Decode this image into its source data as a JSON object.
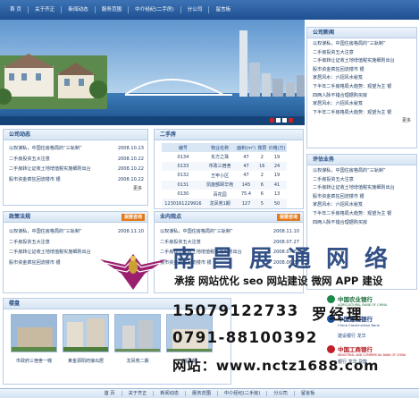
{
  "nav": [
    "首 页",
    "关于齐正",
    "新闻动态",
    "服务范围",
    "中介经纪(二手房)",
    "分公司",
    "留言板"
  ],
  "company_news": {
    "title": "公司新闻",
    "items": [
      "以权谋私，中国住房格局的“三轨制”",
      "二手房投资五大注意",
      "二手房转让证收土地增值税实施细则出台",
      "股市资金疯狂回流楼市  银",
      "家居风水：六招风水秘笈",
      "下半年二手房格局大趋势：观望为主  银",
      "四两人脉不错合理据购买房",
      "家居风水：六招风水秘笈",
      "下半年二手房格局大趋势：观望为主  银"
    ],
    "more": "更多"
  },
  "review": {
    "title": "评估业务",
    "items": [
      "以权谋私，中国住房格局的“三轨制”",
      "二手房投资五大注意",
      "二手房转让证收土地增值税实施细则出台",
      "股市资金疯狂回流楼市  银",
      "家居风水：六招风水秘笈",
      "下半年二手房格局大趋势：观望为主  银",
      "四两人脉不错合理据购买房"
    ],
    "more": "更多"
  },
  "company_dynamic": {
    "title": "公司动态",
    "items": [
      {
        "text": "以权谋私，中国住房格局的“三轨制”",
        "date": "2008.10.23"
      },
      {
        "text": "二手房投资五大注意",
        "date": "2008.10.22"
      },
      {
        "text": "二手房转让证收土地增值税实施细则出台",
        "date": "2008.10.22"
      },
      {
        "text": "股市资金疯狂回流楼市  银",
        "date": "2008.10.22"
      }
    ],
    "more": "更多"
  },
  "policy": {
    "title": "政策法规",
    "tag": "我要咨询",
    "items": [
      {
        "text": "以权谋私，中国住房格局的“三轨制”",
        "date": "2008.11.10"
      },
      {
        "text": "二手房投资五大注意",
        "date": ""
      },
      {
        "text": "二手房转让证收土地增值税实施细则出台",
        "date": ""
      },
      {
        "text": "股市资金疯狂回流楼市  银",
        "date": ""
      }
    ]
  },
  "secondhand": {
    "title": "二手房",
    "columns": [
      "编号",
      "物业名称",
      "面积(m²)",
      "楼层",
      "价格(万)"
    ],
    "rows": [
      [
        "0134",
        "东方之珠",
        "47",
        "2",
        "19"
      ],
      [
        "0133",
        "市政三宿舍",
        "47",
        "16",
        "24"
      ],
      [
        "0132",
        "王牢小区",
        "47",
        "2",
        "19"
      ],
      [
        "0131",
        "凯旋额颐华苑",
        "145",
        "6",
        "41"
      ],
      [
        "0130",
        "百花园",
        "75.4",
        "6",
        "13"
      ],
      [
        "1230161229916",
        "龙凤苑1期",
        "127",
        "5",
        "50"
      ]
    ]
  },
  "industry": {
    "title": "业内观点",
    "tag": "我要咨询",
    "items": [
      {
        "text": "以权谋私，中国住房格局的“三轨制”",
        "date": "2008.11.10"
      },
      {
        "text": "二手房投资五大注意",
        "date": "2008.07.27"
      },
      {
        "text": "二手房转让证收土地增值税实施细则出台",
        "date": "2008.07.02"
      },
      {
        "text": "股市资金疯狂回流楼市  银",
        "date": "2008.06.30"
      }
    ]
  },
  "properties": {
    "title": "楼盘",
    "items": [
      "市政府三宿舍一幢",
      "某金源阳府接出居",
      "龙凤苑二期",
      "桃园观"
    ]
  },
  "watermark": {
    "company": "南昌展通网络",
    "services": "承接 网站优化 seo 网站建设 微网 APP 建设",
    "phone": "15079122733",
    "contact": "罗经理",
    "tel": "0791-88100392",
    "site": "网站：www.nctz1688.com"
  },
  "banks": {
    "abc_cn": "中国农业银行",
    "abc_en": "AGRICULTURAL BANK OF CHINA",
    "ccb_cn": "中国建设银行",
    "ccb_en": "China Construction Bank",
    "sub1": "建设银行",
    "sub2": "龙华",
    "icbc_cn": "中国工商银行",
    "icbc_en": "INDUSTRIAL AND COMMERCIAL BANK OF CHINA",
    "footer": "银行  龙华  贷款"
  },
  "footer_nav": [
    "首 页",
    "关于齐正",
    "新闻动态",
    "服务范围",
    "中介经纪(二手房)",
    "分公司",
    "留言板"
  ],
  "colors": {
    "accent": "#1e4f90",
    "tag": "#e07a1d"
  }
}
